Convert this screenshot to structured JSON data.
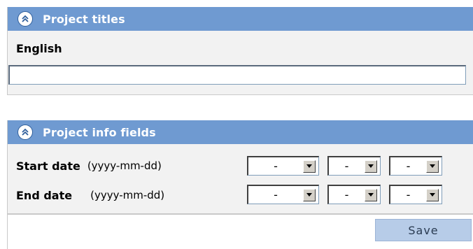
{
  "titles_panel": {
    "header": "Project titles",
    "english_label": "English",
    "english_value": ""
  },
  "info_panel": {
    "header": "Project info fields",
    "start_label": "Start date",
    "start_format": "(yyyy-mm-dd)",
    "end_label": "End date",
    "end_format": "(yyyy-mm-dd)",
    "start_year": "-",
    "start_month": "-",
    "start_day": "-",
    "end_year": "-",
    "end_month": "-",
    "end_day": "-"
  },
  "footer": {
    "save_label": "Save"
  },
  "icons": {
    "collapse": "double-chevron-up-icon",
    "dropdown": "triangle-down-icon"
  },
  "colors": {
    "header_bg": "#6f9ad1",
    "panel_bg": "#f2f2f2",
    "save_bg": "#b7cce8"
  }
}
